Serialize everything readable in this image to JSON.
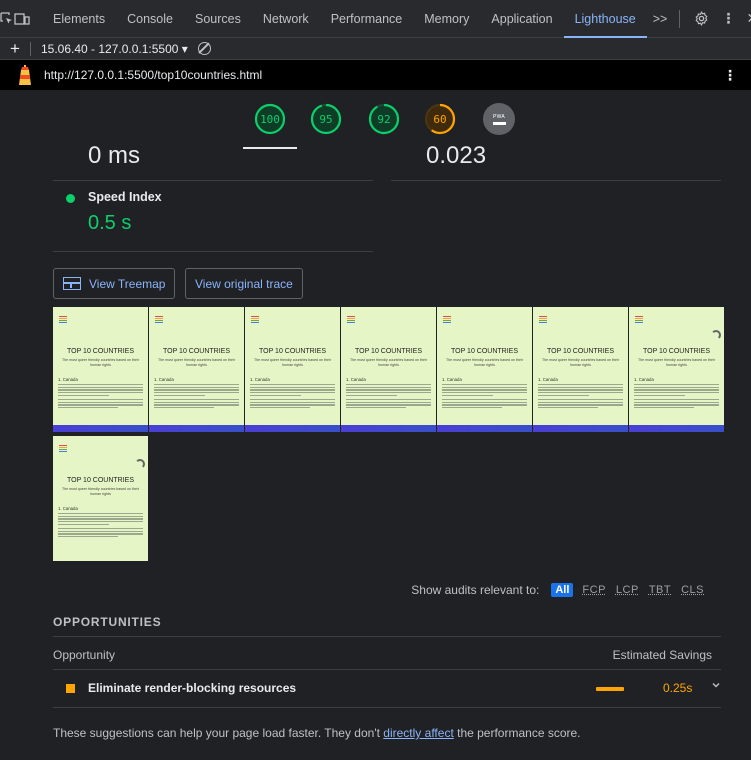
{
  "devtools": {
    "tabs": [
      "Elements",
      "Console",
      "Sources",
      "Network",
      "Performance",
      "Memory",
      "Application",
      "Lighthouse"
    ],
    "active_tab": "Lighthouse",
    "more_label": ">>"
  },
  "report_bar": {
    "selected_report": "15.06.40 - 127.0.0.1:5500 ▾"
  },
  "url_bar": {
    "url": "http://127.0.0.1:5500/top10countries.html"
  },
  "scores": [
    {
      "label": "100",
      "value": 100,
      "color": "#0cce6b"
    },
    {
      "label": "95",
      "value": 95,
      "color": "#0cce6b"
    },
    {
      "label": "92",
      "value": 92,
      "color": "#0cce6b"
    },
    {
      "label": "60",
      "value": 60,
      "color": "#ffa400"
    }
  ],
  "pwa_badge": "PWA",
  "metrics": {
    "top_left_value": "0 ms",
    "top_right_value": "0.023",
    "speed_index": {
      "title": "Speed Index",
      "value": "0.5 s"
    }
  },
  "buttons": {
    "treemap": "View Treemap",
    "trace": "View original trace"
  },
  "filmstrip": {
    "title": "TOP 10 COUNTRIES",
    "subtitle": "The most queer friendly countries based on their human rights",
    "heading": "1. Canada",
    "frame_count": 8
  },
  "audit_filter": {
    "label": "Show audits relevant to:",
    "all": "All",
    "filters": [
      "FCP",
      "LCP",
      "TBT",
      "CLS"
    ]
  },
  "opportunities": {
    "section_title": "OPPORTUNITIES",
    "header_left": "Opportunity",
    "header_right": "Estimated Savings",
    "items": [
      {
        "title": "Eliminate render-blocking resources",
        "savings": "0.25s"
      }
    ],
    "note_before": "These suggestions can help your page load faster. They don't ",
    "note_link": "directly affect",
    "note_after": " the performance score."
  },
  "colors": {
    "pass": "#0cce6b",
    "average": "#ffa400",
    "link": "#8ab4f8"
  }
}
